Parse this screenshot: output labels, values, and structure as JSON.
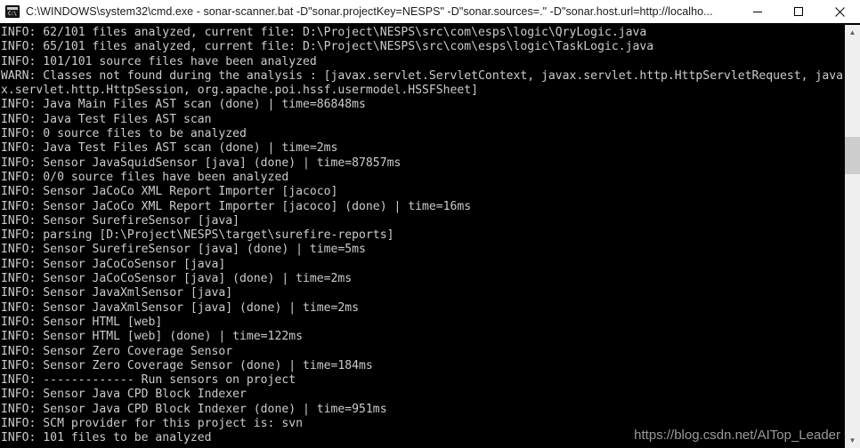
{
  "window": {
    "title": "C:\\WINDOWS\\system32\\cmd.exe - sonar-scanner.bat  -D\"sonar.projectKey=NESPS\" -D\"sonar.sources=.\" -D\"sonar.host.url=http://localho...",
    "icon": "cmd-console-icon",
    "icon_prompt": "C:\\",
    "background_color": "#000000",
    "title_bar_color": "#ffffff",
    "text_color": "#cccccc"
  },
  "controls": {
    "minimize": "minimize-icon",
    "maximize": "maximize-icon",
    "close": "close-icon"
  },
  "scrollbar": {
    "up_arrow": "▲",
    "down_arrow": "▼",
    "thumb": "scroll-thumb"
  },
  "console": {
    "lines": [
      "INFO: 62/101 files analyzed, current file: D:\\Project\\NESPS\\src\\com\\esps\\logic\\QryLogic.java",
      "INFO: 65/101 files analyzed, current file: D:\\Project\\NESPS\\src\\com\\esps\\logic\\TaskLogic.java",
      "INFO: 101/101 source files have been analyzed",
      "WARN: Classes not found during the analysis : [javax.servlet.ServletContext, javax.servlet.http.HttpServletRequest, java",
      "x.servlet.http.HttpSession, org.apache.poi.hssf.usermodel.HSSFSheet]",
      "INFO: Java Main Files AST scan (done) | time=86848ms",
      "INFO: Java Test Files AST scan",
      "INFO: 0 source files to be analyzed",
      "INFO: Java Test Files AST scan (done) | time=2ms",
      "INFO: Sensor JavaSquidSensor [java] (done) | time=87857ms",
      "INFO: 0/0 source files have been analyzed",
      "INFO: Sensor JaCoCo XML Report Importer [jacoco]",
      "INFO: Sensor JaCoCo XML Report Importer [jacoco] (done) | time=16ms",
      "INFO: Sensor SurefireSensor [java]",
      "INFO: parsing [D:\\Project\\NESPS\\target\\surefire-reports]",
      "INFO: Sensor SurefireSensor [java] (done) | time=5ms",
      "INFO: Sensor JaCoCoSensor [java]",
      "INFO: Sensor JaCoCoSensor [java] (done) | time=2ms",
      "INFO: Sensor JavaXmlSensor [java]",
      "INFO: Sensor JavaXmlSensor [java] (done) | time=2ms",
      "INFO: Sensor HTML [web]",
      "INFO: Sensor HTML [web] (done) | time=122ms",
      "INFO: Sensor Zero Coverage Sensor",
      "INFO: Sensor Zero Coverage Sensor (done) | time=184ms",
      "INFO: ------------- Run sensors on project",
      "INFO: Sensor Java CPD Block Indexer",
      "INFO: Sensor Java CPD Block Indexer (done) | time=951ms",
      "INFO: SCM provider for this project is: svn",
      "INFO: 101 files to be analyzed"
    ]
  },
  "watermark": {
    "text": "https://blog.csdn.net/AITop_Leader"
  }
}
